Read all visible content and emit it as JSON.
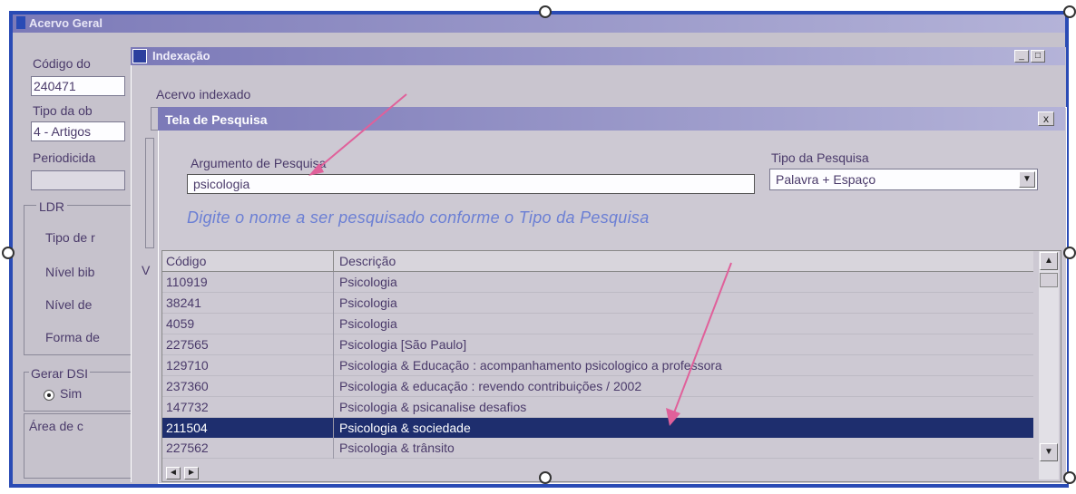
{
  "back_window": {
    "title": "Acervo Geral",
    "codigo_label": "Código do",
    "codigo_value": "240471",
    "tipo_label": "Tipo da ob",
    "tipo_value": "4 - Artigos",
    "periodicidade_label": "Periodicida",
    "ldr_label": "LDR",
    "tipo_de_label": "Tipo de r",
    "nivel_bib_label": "Nível bib",
    "nivel_de_label": "Nível de",
    "forma_de_label": "Forma de",
    "gerar_dsi_label": "Gerar DSI",
    "sim_label": "Sim",
    "area_label": "Área de c",
    "v_label": "V"
  },
  "index_window": {
    "title": "Indexação",
    "acervo_label": "Acervo indexado"
  },
  "search_dialog": {
    "title": "Tela de Pesquisa",
    "close_label": "x",
    "arg_label": "Argumento de Pesquisa",
    "arg_value": "psicologia",
    "tipo_label": "Tipo da Pesquisa",
    "tipo_value": "Palavra + Espaço",
    "hint": "Digite o nome a ser pesquisado conforme o Tipo da Pesquisa"
  },
  "results": {
    "headers": [
      "Código",
      "Descrição"
    ],
    "rows": [
      {
        "code": "110919",
        "desc": "Psicologia"
      },
      {
        "code": "38241",
        "desc": "Psicologia"
      },
      {
        "code": "4059",
        "desc": "Psicologia"
      },
      {
        "code": "227565",
        "desc": "Psicologia  [São Paulo]"
      },
      {
        "code": "129710",
        "desc": "Psicologia & Educação : acompanhamento psicologico a professora"
      },
      {
        "code": "237360",
        "desc": "Psicologia & educação : revendo contribuições  / 2002"
      },
      {
        "code": "147732",
        "desc": "Psicologia & psicanalise  desafios"
      },
      {
        "code": "211504",
        "desc": "Psicologia & sociedade",
        "selected": true
      },
      {
        "code": "227562",
        "desc": "Psicologia & trânsito"
      }
    ]
  },
  "colors": {
    "frame": "#2a4bb5",
    "selection": "#1e2e6e",
    "arrow": "#e0609a",
    "hint": "#6b7fd4"
  }
}
